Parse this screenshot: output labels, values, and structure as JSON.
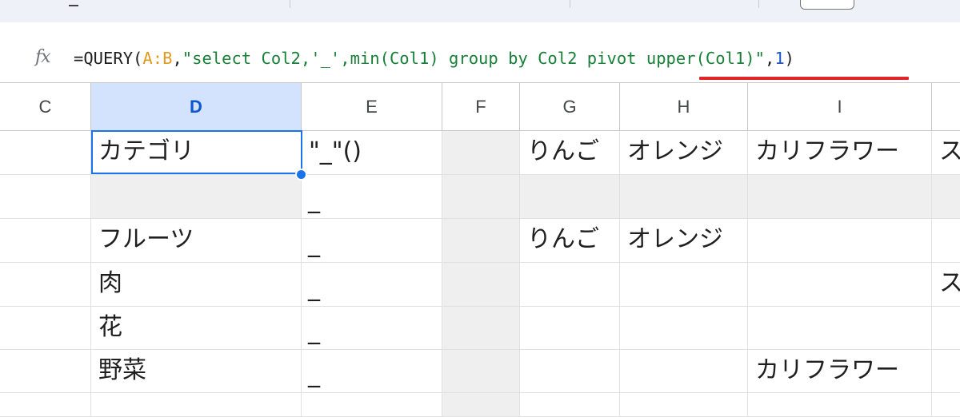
{
  "formula_bar": {
    "fx_label": "fx",
    "formula_parts": [
      {
        "t": "=QUERY(",
        "c": "plain"
      },
      {
        "t": "A:B",
        "c": "ref"
      },
      {
        "t": ",",
        "c": "plain"
      },
      {
        "t": "\"select Col2,'_',min(Col1) group by Col2 pivot upper(Col1)\"",
        "c": "str"
      },
      {
        "t": ",",
        "c": "plain"
      },
      {
        "t": "1",
        "c": "num"
      },
      {
        "t": ")",
        "c": "plain"
      }
    ],
    "highlighted_text": "pivot upper(Col1)",
    "highlight_color": "#e0262b"
  },
  "columns": [
    {
      "label": "C",
      "selected": false
    },
    {
      "label": "D",
      "selected": true
    },
    {
      "label": "E",
      "selected": false
    },
    {
      "label": "F",
      "selected": false
    },
    {
      "label": "G",
      "selected": false
    },
    {
      "label": "H",
      "selected": false
    },
    {
      "label": "I",
      "selected": false
    },
    {
      "label": "",
      "selected": false
    }
  ],
  "rows": [
    [
      "",
      "カテゴリ",
      "\"_\"()",
      "",
      "りんご",
      "オレンジ",
      "カリフラワー",
      "ス"
    ],
    [
      "",
      "",
      "_",
      "",
      "",
      "",
      "",
      ""
    ],
    [
      "",
      "フルーツ",
      "_",
      "",
      "りんご",
      "オレンジ",
      "",
      ""
    ],
    [
      "",
      "肉",
      "_",
      "",
      "",
      "",
      "",
      "ス"
    ],
    [
      "",
      "花",
      "_",
      "",
      "",
      "",
      "",
      ""
    ],
    [
      "",
      "野菜",
      "_",
      "",
      "",
      "",
      "カリフラワー",
      ""
    ],
    [
      "",
      "",
      "",
      "",
      "",
      "",
      "",
      ""
    ]
  ],
  "active_cell": "D1",
  "colors": {
    "accent": "#1a73e8",
    "selected_header_bg": "#d3e3fd",
    "gray_cell": "#efefef"
  }
}
